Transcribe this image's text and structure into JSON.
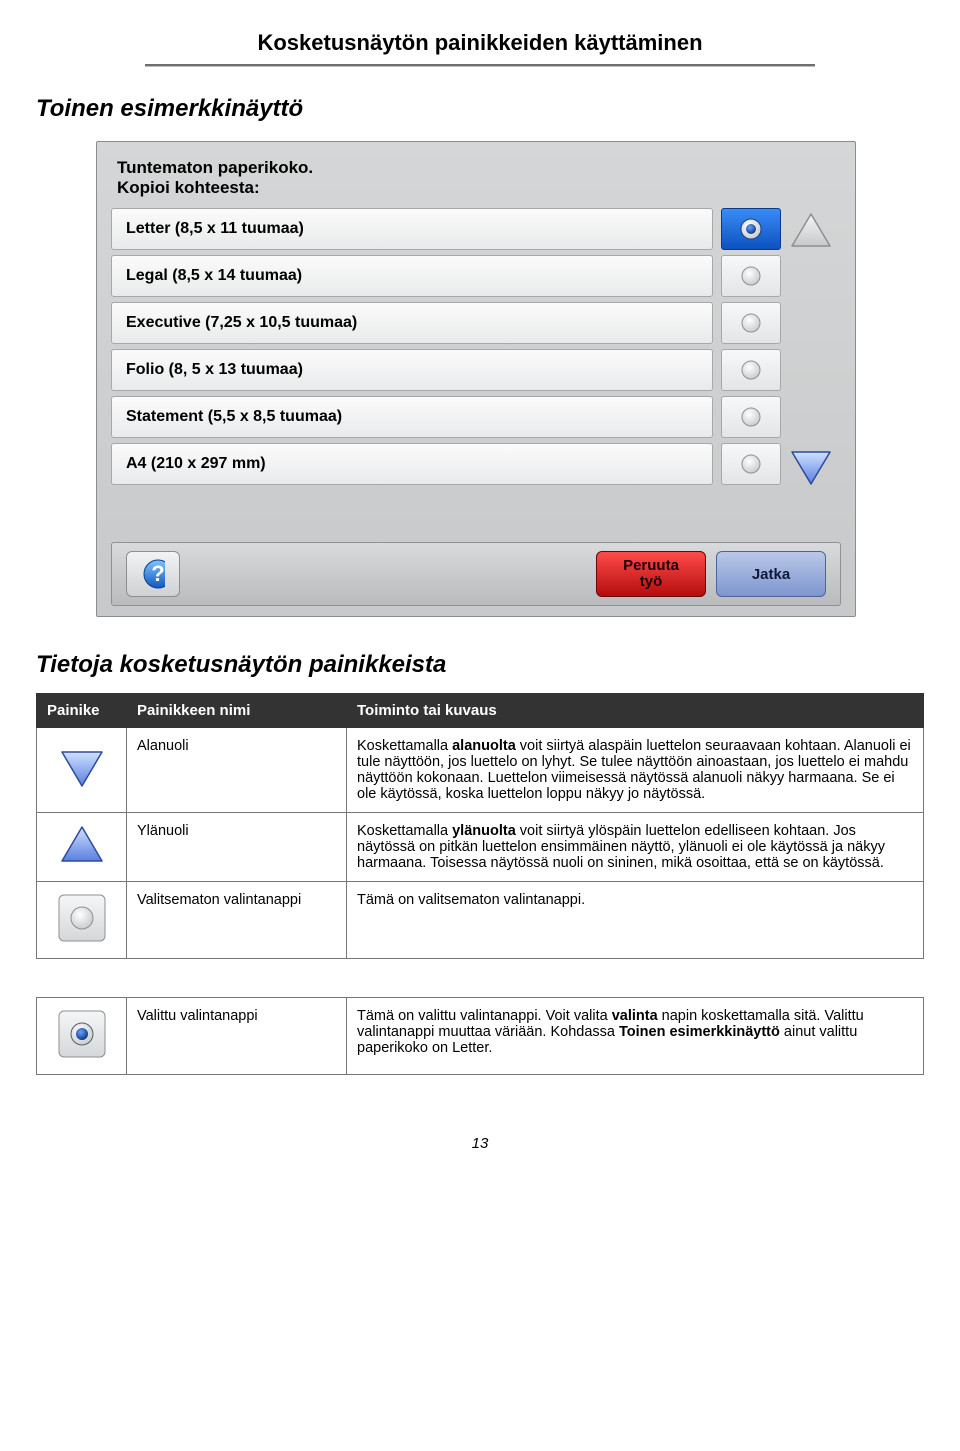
{
  "page": {
    "title": "Kosketusnäytön painikkeiden käyttäminen",
    "subheading": "Toinen esimerkkinäyttö",
    "section_heading": "Tietoja kosketusnäytön painikkeista",
    "page_number": "13"
  },
  "panel": {
    "head_line1": "Tuntematon paperikoko.",
    "head_line2": "Kopioi kohteesta:",
    "items": [
      "Letter (8,5 x 11 tuumaa)",
      "Legal (8,5 x 14 tuumaa)",
      "Executive (7,25 x 10,5 tuumaa)",
      "Folio (8, 5 x 13 tuumaa)",
      "Statement (5,5 x 8,5 tuumaa)",
      "A4 (210 x 297 mm)"
    ],
    "cancel_line1": "Peruuta",
    "cancel_line2": "työ",
    "continue_label": "Jatka"
  },
  "table": {
    "headers": {
      "button": "Painike",
      "name": "Painikkeen nimi",
      "desc": "Toiminto tai kuvaus"
    },
    "rows": [
      {
        "name": "Alanuoli",
        "desc": "Koskettamalla <b>alanuolta</b> voit siirtyä alaspäin luettelon seuraavaan kohtaan. Alanuoli ei tule näyttöön, jos luettelo on lyhyt. Se tulee näyttöön ainoastaan, jos luettelo ei mahdu näyttöön kokonaan. Luettelon viimeisessä näytössä alanuoli näkyy harmaana. Se ei ole käytössä, koska luettelon loppu näkyy jo näytössä."
      },
      {
        "name": "Ylänuoli",
        "desc": "Koskettamalla <b>ylänuolta</b> voit siirtyä ylöspäin luettelon edelliseen kohtaan. Jos näytössä on pitkän luettelon ensimmäinen näyttö, ylänuoli ei ole käytössä ja näkyy harmaana. Toisessa näytössä nuoli on sininen, mikä osoittaa, että se on käytössä."
      },
      {
        "name": "Valitsematon valintanappi",
        "desc": "Tämä on valitsematon valintanappi."
      }
    ],
    "rows2": [
      {
        "name": "Valittu valintanappi",
        "desc": "Tämä on valittu valintanappi. Voit valita <b>valinta</b> napin koskettamalla sitä. Valittu valintanappi muuttaa väriään. Kohdassa <b>Toinen esimerkkinäyttö</b> ainut valittu paperikoko on Letter."
      }
    ]
  }
}
